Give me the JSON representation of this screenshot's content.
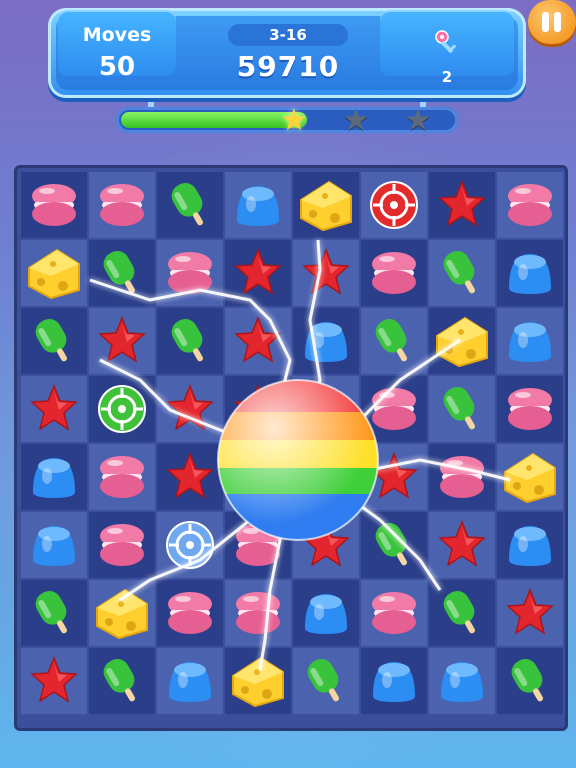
{
  "hud": {
    "moves_label": "Moves",
    "moves_value": "50",
    "level": "3-16",
    "score": "59710",
    "keys_count": "2",
    "key_icon": "key-icon",
    "pause_icon": "pause-icon"
  },
  "progress": {
    "fill_fraction": 0.56,
    "stars_earned": 1,
    "stars_total": 3
  },
  "colors": {
    "macaron": "#f27aa6",
    "gumdrop": "#2c8df2",
    "popsicle": "#39c33c",
    "star": "#e3262d",
    "target": "#e32b2b",
    "accent": "#2f8ef0",
    "pause": "#f39a1e"
  },
  "board": {
    "rows": [
      [
        "macaron",
        "macaron",
        "popsicle",
        "gumdrop",
        "cheese",
        "target",
        "star",
        "macaron"
      ],
      [
        "cheese",
        "popsicle",
        "macaron",
        "star",
        "star",
        "macaron",
        "popsicle",
        "gumdrop"
      ],
      [
        "popsicle",
        "star",
        "popsicle",
        "star",
        "gumdrop",
        "popsicle",
        "cheese",
        "gumdrop"
      ],
      [
        "star",
        "target-green",
        "star",
        "star",
        "star",
        "macaron",
        "popsicle",
        "macaron"
      ],
      [
        "gumdrop",
        "macaron",
        "star",
        "star",
        "macaron",
        "star",
        "macaron",
        "cheese"
      ],
      [
        "gumdrop",
        "macaron",
        "target-blue",
        "macaron",
        "star",
        "popsicle",
        "star",
        "gumdrop"
      ],
      [
        "popsicle",
        "cheese",
        "macaron",
        "macaron",
        "gumdrop",
        "macaron",
        "popsicle",
        "star"
      ],
      [
        "star",
        "popsicle",
        "gumdrop",
        "cheese",
        "popsicle",
        "gumdrop",
        "gumdrop",
        "popsicle"
      ]
    ],
    "special": "rainbow-ball-icon"
  }
}
